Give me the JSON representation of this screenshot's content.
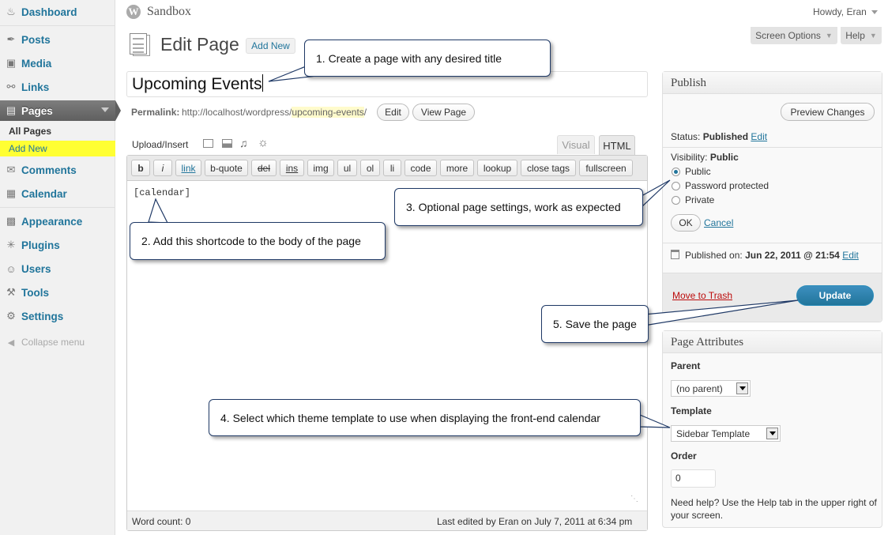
{
  "site": {
    "name": "Sandbox",
    "greeting": "Howdy, Eran"
  },
  "header": {
    "screen_options": "Screen Options",
    "help": "Help"
  },
  "sidebar": {
    "items": [
      {
        "label": "Dashboard",
        "icon": "dashboard-icon"
      },
      {
        "label": "Posts",
        "icon": "pin-icon"
      },
      {
        "label": "Media",
        "icon": "media-icon"
      },
      {
        "label": "Links",
        "icon": "link-icon"
      },
      {
        "label": "Pages",
        "icon": "pages-icon"
      },
      {
        "label": "Comments",
        "icon": "comment-icon"
      },
      {
        "label": "Calendar",
        "icon": "calendar-icon"
      },
      {
        "label": "Appearance",
        "icon": "appearance-icon"
      },
      {
        "label": "Plugins",
        "icon": "plugin-icon"
      },
      {
        "label": "Users",
        "icon": "users-icon"
      },
      {
        "label": "Tools",
        "icon": "tools-icon"
      },
      {
        "label": "Settings",
        "icon": "settings-icon"
      }
    ],
    "sub_items": [
      "All Pages",
      "Add New"
    ],
    "collapse": "Collapse menu",
    "highlight_color": "#ffff33"
  },
  "page": {
    "heading": "Edit Page",
    "add_new": "Add New"
  },
  "editor": {
    "title_value": "Upcoming Events",
    "permalink_label": "Permalink:",
    "permalink_base": "http://localhost/wordpress/",
    "permalink_slug": "upcoming-events",
    "permalink_end": "/",
    "edit_btn": "Edit",
    "view_btn": "View Page",
    "upload_label": "Upload/Insert",
    "tab_visual": "Visual",
    "tab_html": "HTML",
    "quicktags": [
      "b",
      "i",
      "link",
      "b-quote",
      "del",
      "ins",
      "img",
      "ul",
      "ol",
      "li",
      "code",
      "more",
      "lookup",
      "close tags",
      "fullscreen"
    ],
    "content": "[calendar]",
    "word_count": "Word count: 0",
    "last_edited": "Last edited by Eran on July 7, 2011 at 6:34 pm"
  },
  "publish": {
    "title": "Publish",
    "preview": "Preview Changes",
    "status_label": "Status:",
    "status_value": "Published",
    "edit": "Edit",
    "visibility_label": "Visibility:",
    "visibility_value": "Public",
    "options": [
      "Public",
      "Password protected",
      "Private"
    ],
    "selected": "Public",
    "ok": "OK",
    "cancel": "Cancel",
    "published_on_label": "Published on:",
    "published_on_value": "Jun 22, 2011 @ 21:54",
    "trash": "Move to Trash",
    "update": "Update",
    "update_color": "#21759b"
  },
  "attributes": {
    "title": "Page Attributes",
    "parent_label": "Parent",
    "parent_value": "(no parent)",
    "template_label": "Template",
    "template_value": "Sidebar Template",
    "order_label": "Order",
    "order_value": "0",
    "help_text": "Need help? Use the Help tab in the upper right of your screen."
  },
  "callouts": {
    "c1": "1. Create a page with any desired title",
    "c2": "2. Add this shortcode to the body of the page",
    "c3": "3.  Optional page settings, work as expected",
    "c4": "4. Select which theme template to use when displaying the front-end calendar",
    "c5": "5. Save the page"
  }
}
